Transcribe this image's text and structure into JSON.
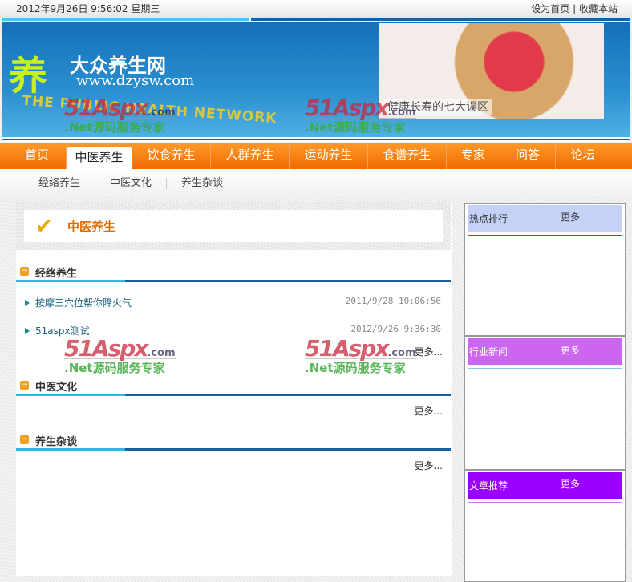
{
  "topbar": {
    "datetime": "2012年9月26日 9:56:02 星期三",
    "set_home": "设为首页",
    "separator": "|",
    "bookmark": "收藏本站"
  },
  "banner": {
    "logo_char": "养",
    "site_name": "大众养生网",
    "site_url": "www.dzysw.com",
    "site_en": "THE PUBLIC HEALTH NETWORK",
    "promo_caption": "健康长寿的七大误区"
  },
  "nav": [
    "首页",
    "中医养生",
    "饮食养生",
    "人群养生",
    "运动养生",
    "食谱养生",
    "专家",
    "问答",
    "论坛"
  ],
  "subnav": [
    "经络养生",
    "中医文化",
    "养生杂谈"
  ],
  "crumb": {
    "title": "中医养生"
  },
  "sections": [
    {
      "title": "经络养生",
      "items": [
        {
          "title": "按摩三穴位帮你降火气",
          "date": "2011/9/28 10:06:56"
        },
        {
          "title": "51aspx测试",
          "date": "2012/9/26 9:36:30"
        }
      ],
      "more": "更多..."
    },
    {
      "title": "中医文化",
      "items": [],
      "more": "更多..."
    },
    {
      "title": "养生杂谈",
      "items": [],
      "more": "更多..."
    }
  ],
  "sidebar": [
    {
      "title": "热点排行",
      "more": "更多",
      "color": "#c5d2f7",
      "line": "#c03020"
    },
    {
      "title": "行业新闻",
      "more": "更多",
      "color": "#cc66ee",
      "line": "#88c8e0"
    },
    {
      "title": "文章推荐",
      "more": "更多",
      "color": "#9900ff",
      "line": "#c080f0"
    }
  ],
  "watermark": {
    "brand": "51Aspx",
    "domain": ".com",
    "slogan": ".Net源码服务专家"
  },
  "colors": {
    "nav": "#f47a10",
    "accent": "#1a5f9c"
  }
}
